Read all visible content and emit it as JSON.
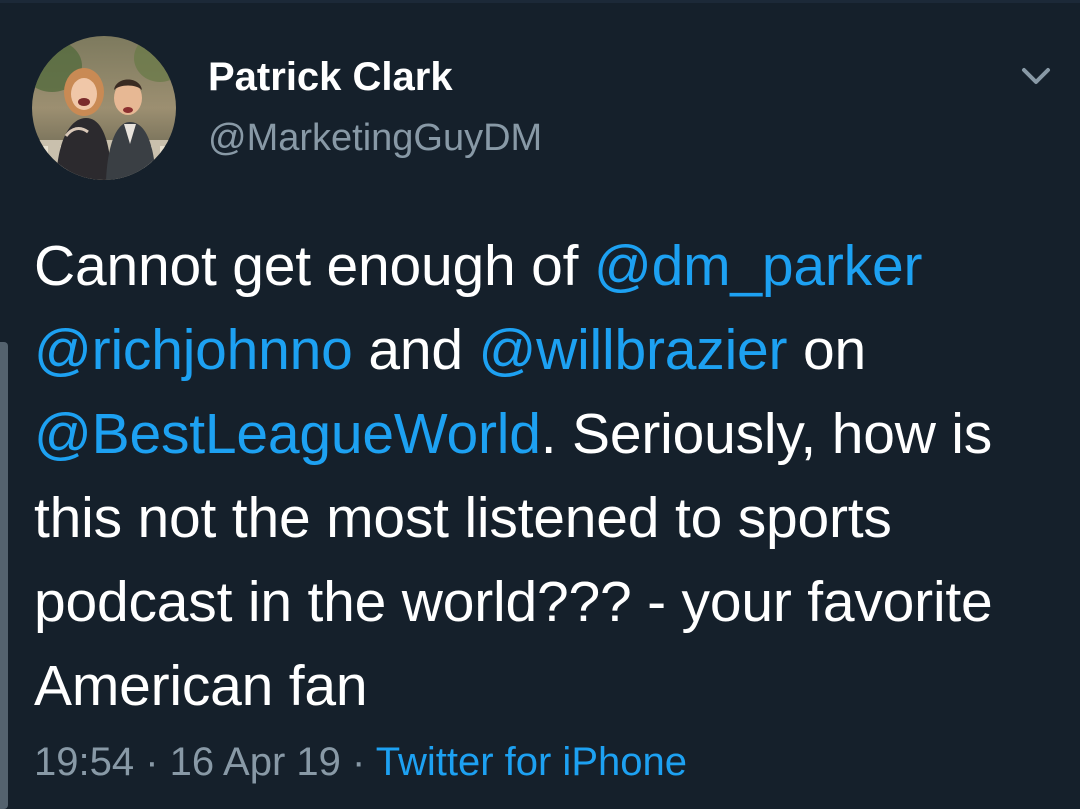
{
  "theme": {
    "background": "#15202b",
    "text": "#ffffff",
    "secondary_text": "#8899a6",
    "link": "#1da1f2"
  },
  "author": {
    "display_name": "Patrick Clark",
    "handle": "@MarketingGuyDM",
    "avatar_icon": "profile-photo"
  },
  "menu": {
    "icon": "chevron-down-icon"
  },
  "tweet": {
    "segments": [
      {
        "type": "text",
        "text": "Cannot get enough of "
      },
      {
        "type": "mention",
        "text": "@dm_parker"
      },
      {
        "type": "text",
        "text": " "
      },
      {
        "type": "mention",
        "text": "@richjohnno"
      },
      {
        "type": "text",
        "text": " and "
      },
      {
        "type": "mention",
        "text": "@willbrazier"
      },
      {
        "type": "text",
        "text": " on "
      },
      {
        "type": "mention",
        "text": "@BestLeagueWorld"
      },
      {
        "type": "text",
        "text": ". Seriously, how is this not the most listened to sports podcast in the world??? - your favorite American fan"
      }
    ]
  },
  "meta": {
    "time": "19:54",
    "separator": " · ",
    "date": "16 Apr 19",
    "source": "Twitter for iPhone"
  }
}
